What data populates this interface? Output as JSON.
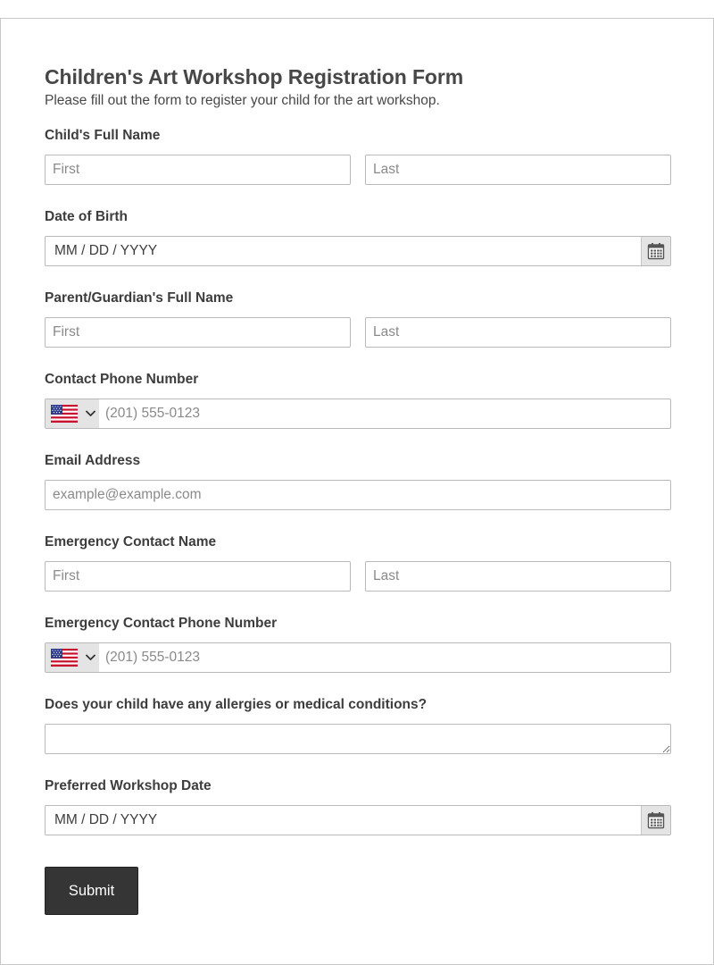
{
  "form": {
    "title": "Children's Art Workshop Registration Form",
    "subtitle": "Please fill out the form to register your child for the art workshop.",
    "submit_label": "Submit"
  },
  "fields": {
    "child_name": {
      "label": "Child's Full Name",
      "first_placeholder": "First",
      "last_placeholder": "Last"
    },
    "dob": {
      "label": "Date of Birth",
      "placeholder": "MM / DD / YYYY",
      "icon": "calendar-icon"
    },
    "parent_name": {
      "label": "Parent/Guardian's Full Name",
      "first_placeholder": "First",
      "last_placeholder": "Last"
    },
    "contact_phone": {
      "label": "Contact Phone Number",
      "placeholder": "(201) 555-0123",
      "country_icon": "us-flag-icon"
    },
    "email": {
      "label": "Email Address",
      "placeholder": "example@example.com"
    },
    "emergency_name": {
      "label": "Emergency Contact Name",
      "first_placeholder": "First",
      "last_placeholder": "Last"
    },
    "emergency_phone": {
      "label": "Emergency Contact Phone Number",
      "placeholder": "(201) 555-0123",
      "country_icon": "us-flag-icon"
    },
    "allergies": {
      "label": "Does your child have any allergies or medical conditions?"
    },
    "workshop_date": {
      "label": "Preferred Workshop Date",
      "placeholder": "MM / DD / YYYY",
      "icon": "calendar-icon"
    }
  },
  "colors": {
    "text": "#3d3d3d",
    "border": "#b9b9b9",
    "button_bg": "#353535",
    "button_text": "#ffffff",
    "icon_bg": "#e4e4e4"
  }
}
